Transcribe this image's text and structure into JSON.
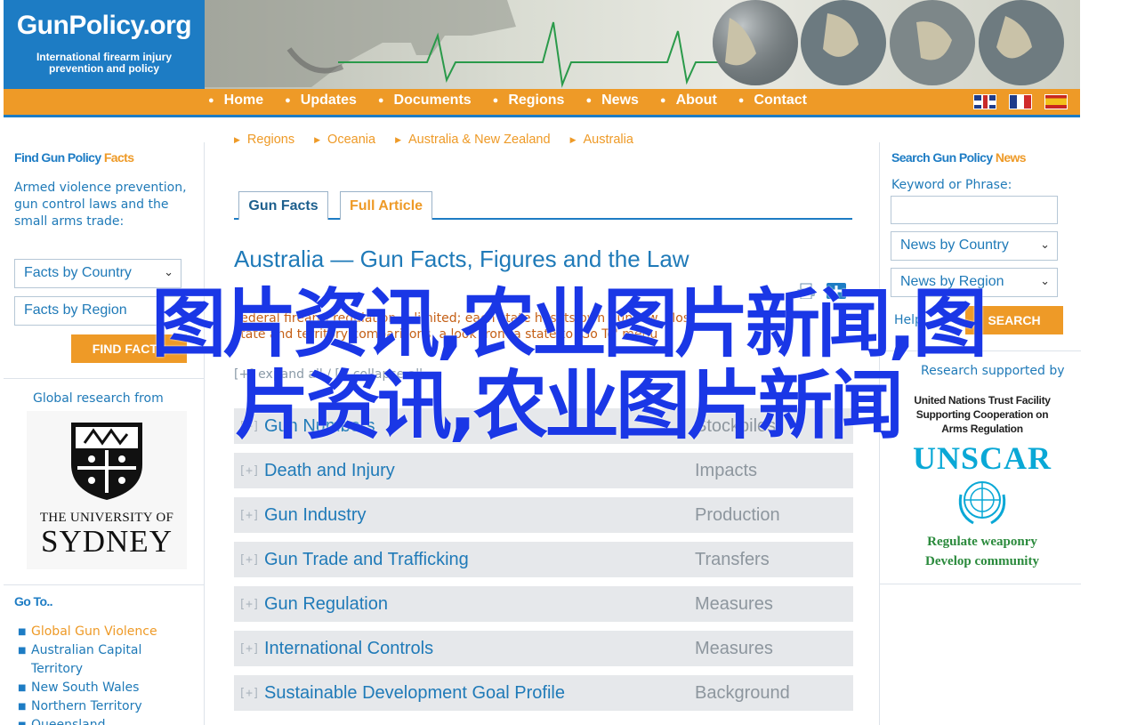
{
  "logo": {
    "name": "GunPolicy.org",
    "tagline_line1": "International firearm injury",
    "tagline_line2": "prevention and policy"
  },
  "nav": {
    "items": [
      "Home",
      "Updates",
      "Documents",
      "Regions",
      "News",
      "About",
      "Contact"
    ],
    "flags": [
      "uk-flag-icon",
      "france-flag-icon",
      "spain-flag-icon"
    ]
  },
  "left": {
    "facts_title_a": "Find Gun Policy ",
    "facts_title_b": "Facts",
    "facts_desc": "Armed violence prevention, gun control laws and the small arms trade:",
    "country_select": "Facts by Country",
    "region_select": "Facts by Region",
    "find_button": "FIND FACTS",
    "research_text": "Global research from",
    "university_line1": "THE UNIVERSITY OF",
    "university_line2": "SYDNEY",
    "goto_title": "Go To..",
    "goto_items": [
      "Global Gun Violence",
      "Australian Capital Territory",
      "New South Wales",
      "Northern Territory",
      "Queensland"
    ]
  },
  "main": {
    "breadcrumbs": [
      "Regions",
      "Oceania",
      "Australia & New Zealand",
      "Australia"
    ],
    "tabs": [
      "Gun Facts",
      "Full Article"
    ],
    "title": "Australia — Gun Facts, Figures and the Law",
    "intro": "Federal firearm regulation is limited; each state has its own gun law. Most state and territory comparisons, a look from a state to 'Go To' menu",
    "expand_text": "[+] expand all / [-] collapse all",
    "rows": [
      {
        "label": "Gun Numbers",
        "category": "Stockpiles"
      },
      {
        "label": "Death and Injury",
        "category": "Impacts"
      },
      {
        "label": "Gun Industry",
        "category": "Production"
      },
      {
        "label": "Gun Trade and Trafficking",
        "category": "Transfers"
      },
      {
        "label": "Gun Regulation",
        "category": "Measures"
      },
      {
        "label": "International Controls",
        "category": "Measures"
      },
      {
        "label": "Sustainable Development Goal Profile",
        "category": "Background"
      }
    ],
    "row_toggle": "[+]"
  },
  "right": {
    "title_a": "Search Gun Policy ",
    "title_b": "News",
    "keyword_label": "Keyword or Phrase:",
    "news_country": "News by Country",
    "news_region": "News by Region",
    "help_text": "Help",
    "search_button": "SEARCH",
    "supported_text": "Research supported by",
    "un_line1": "United Nations Trust Facility",
    "un_line2": "Supporting Cooperation on",
    "un_line3": "Arms Regulation",
    "unscar": "UNSCAR",
    "slogan1": "Regulate weaponry",
    "slogan2": "Develop community"
  },
  "watermark": {
    "line1": "图片资讯,农业图片新闻,图",
    "line2": "片资讯,农业图片新闻"
  },
  "colors": {
    "brand_blue": "#1d7cc4",
    "brand_orange": "#ee9a27",
    "watermark_blue": "#1a37e6"
  }
}
